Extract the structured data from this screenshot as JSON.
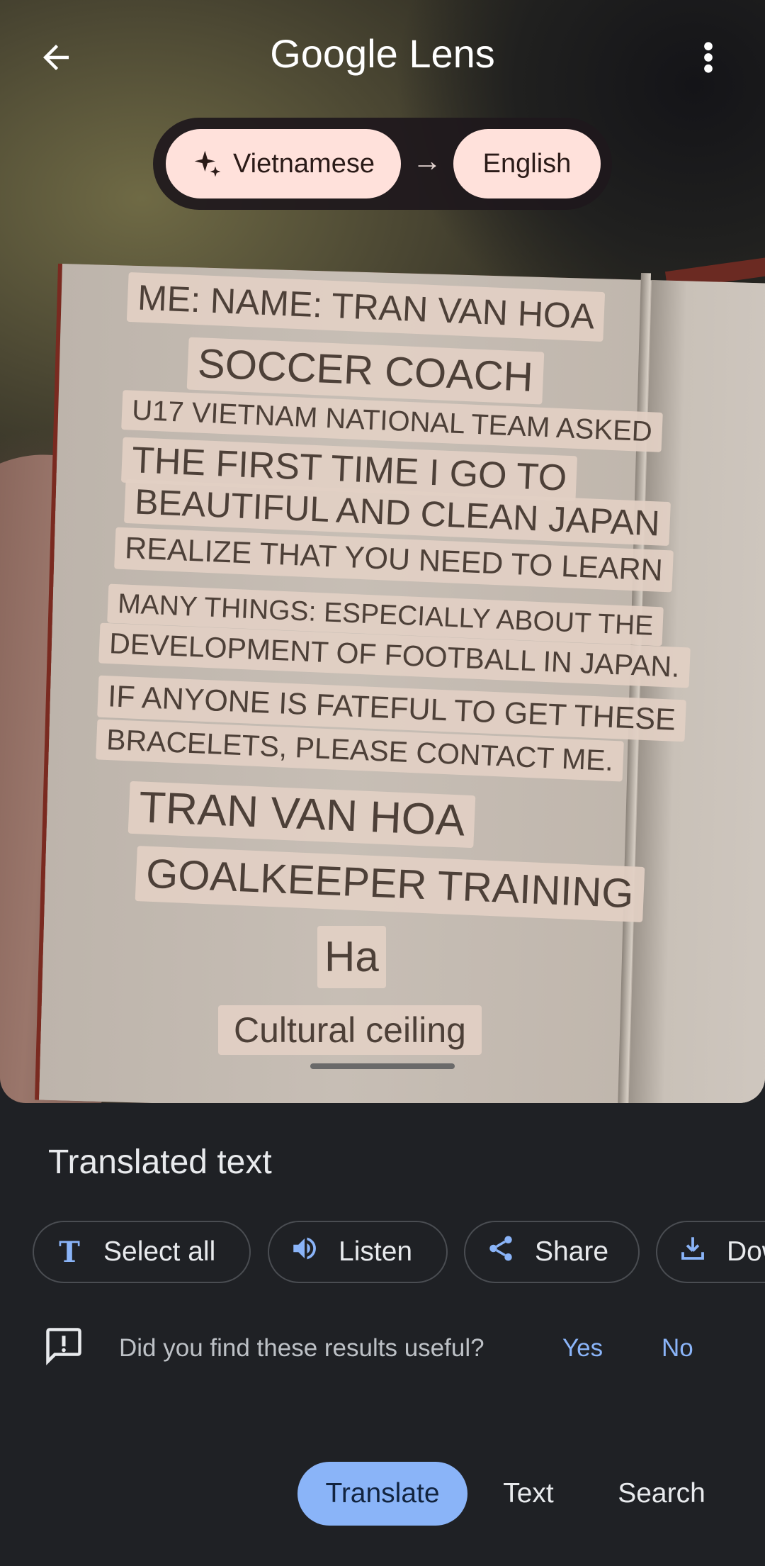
{
  "header": {
    "back_icon": "arrow-left-icon",
    "title_brand": "Google",
    "title_product": "Lens",
    "menu_icon": "more-vert-icon"
  },
  "language": {
    "source_icon": "sparkle-icon",
    "source": "Vietnamese",
    "arrow": "→",
    "target": "English"
  },
  "overlay_lines": [
    "ME: NAME: TRAN VAN HOA",
    "SOCCER COACH",
    "U17 VIETNAM NATIONAL TEAM ASKED",
    "THE FIRST TIME I GO TO",
    "BEAUTIFUL AND CLEAN JAPAN",
    "REALIZE THAT YOU NEED TO LEARN",
    "MANY THINGS: ESPECIALLY ABOUT THE",
    "DEVELOPMENT OF FOOTBALL IN JAPAN.",
    "IF ANYONE IS FATEFUL TO GET THESE",
    "BRACELETS, PLEASE CONTACT ME.",
    "TRAN VAN HOA",
    "GOALKEEPER TRAINING",
    "Ha",
    "Cultural ceiling"
  ],
  "panel": {
    "heading": "Translated text",
    "actions": [
      {
        "icon": "text-select-icon",
        "label": "Select all"
      },
      {
        "icon": "speaker-icon",
        "label": "Listen"
      },
      {
        "icon": "share-icon",
        "label": "Share"
      },
      {
        "icon": "download-icon",
        "label": "Dow"
      }
    ],
    "feedback": {
      "icon": "feedback-icon",
      "question": "Did you find these results useful?",
      "yes": "Yes",
      "no": "No"
    }
  },
  "tabs": [
    {
      "label": "Translate",
      "active": true
    },
    {
      "label": "Text",
      "active": false
    },
    {
      "label": "Search",
      "active": false
    }
  ],
  "colors": {
    "accent": "#8ab4f8",
    "chip": "#ffe1db",
    "panel_bg": "#1f2125"
  }
}
